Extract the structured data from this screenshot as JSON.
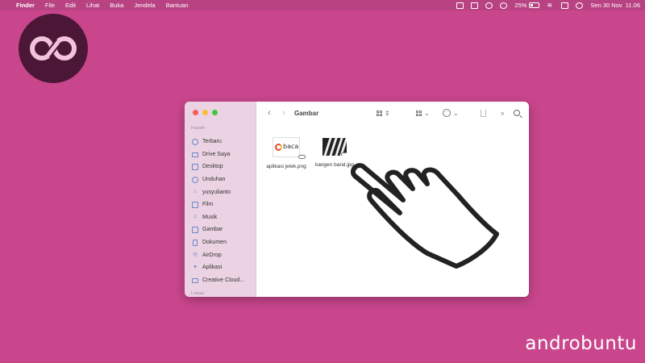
{
  "menubar": {
    "app_name": "Finder",
    "menus": [
      "File",
      "Edit",
      "Lihat",
      "Buka",
      "Jendela",
      "Bantuan"
    ],
    "battery_percent": "25%",
    "battery_level": 0.25,
    "datetime": "Sen 30 Nov  11.06"
  },
  "window": {
    "title": "Gambar",
    "sidebar": {
      "favorites_label": "Favorit",
      "locations_label": "Lokasi",
      "items": [
        {
          "label": "Terbaru",
          "icon": "clock-icon"
        },
        {
          "label": "Drive Saya",
          "icon": "folder-icon"
        },
        {
          "label": "Desktop",
          "icon": "desktop-icon"
        },
        {
          "label": "Unduhan",
          "icon": "download-icon"
        },
        {
          "label": "yusyulianto",
          "icon": "home-icon"
        },
        {
          "label": "Film",
          "icon": "film-icon"
        },
        {
          "label": "Musik",
          "icon": "music-icon"
        },
        {
          "label": "Gambar",
          "icon": "photo-icon"
        },
        {
          "label": "Dokumen",
          "icon": "document-icon"
        },
        {
          "label": "AirDrop",
          "icon": "airdrop-icon"
        },
        {
          "label": "Aplikasi",
          "icon": "apps-icon"
        },
        {
          "label": "Creative Cloud...",
          "icon": "folder-icon"
        }
      ]
    },
    "files": [
      {
        "name": "aplikasi jelek.png",
        "thumb_text": "baca"
      },
      {
        "name": "kangen band.jpg"
      }
    ]
  },
  "watermark": "androbuntu",
  "colors": {
    "background": "#c9468d",
    "logo_circle": "#4c1736",
    "logo_mark": "#f2c4dc",
    "sidebar": "#ecd3e3"
  }
}
